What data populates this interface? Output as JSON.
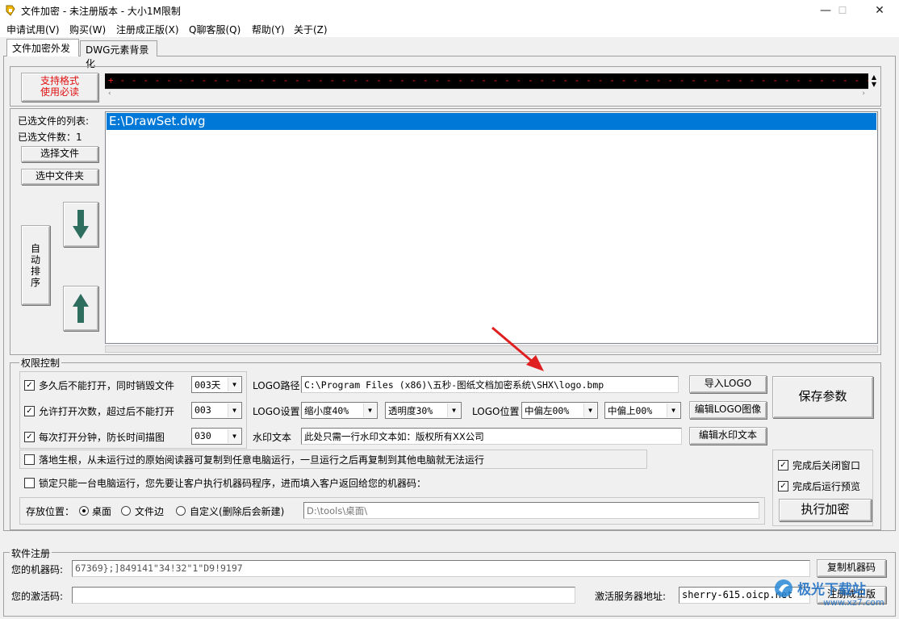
{
  "window": {
    "title": "文件加密 - 未注册版本 - 大小1M限制",
    "minimize": "—",
    "maximize": "☐",
    "close": "✕"
  },
  "menu": [
    "申请试用(V)",
    "购买(W)",
    "注册成正版(X)",
    "Q聊客服(Q)",
    "帮助(Y)",
    "关于(Z)"
  ],
  "tabs": [
    "文件加密外发",
    "DWG元素背景化"
  ],
  "support_button": "支持格式\n使用必读",
  "banner_text": "+ - - - - - - - - - - - - - - - - - - - - - - - - - - - - - - - - - - - - - - - - - - - - - - - - - - - - - - - - - - - - - - - - - - - - - - - - - +",
  "file_list": {
    "list_label": "已选文件的列表:",
    "count_label": "已选文件数：1",
    "select_files": "选择文件",
    "select_folder": "选中文件夹",
    "auto_sort": "自\n动\n排\n序",
    "items": [
      "E:\\DrawSet.dwg"
    ]
  },
  "permission": {
    "group_title": "权限控制",
    "opt1": {
      "checked": true,
      "label": "多久后不能打开，同时销毁文件",
      "value": "003天"
    },
    "opt2": {
      "checked": true,
      "label": "允许打开次数，超过后不能打开",
      "value": "003"
    },
    "opt3": {
      "checked": true,
      "label": "每次打开分钟，防长时间描图",
      "value": "030"
    },
    "logo_path_label": "LOGO路径",
    "logo_path_value": "C:\\Program Files (x86)\\五秒-图纸文档加密系统\\SHX\\logo.bmp",
    "logo_settings_label": "LOGO设置",
    "scale_value": "缩小度40%",
    "opacity_value": "透明度30%",
    "logo_pos_label": "LOGO位置",
    "pos_x_value": "中偏左00%",
    "pos_y_value": "中偏上00%",
    "watermark_label": "水印文本",
    "watermark_value": "此处只需一行水印文本如：版权所有XX公司",
    "import_logo": "导入LOGO",
    "edit_logo": "编辑LOGO图像",
    "edit_watermark": "编辑水印文本",
    "save_params": "保存参数",
    "root_opt": {
      "checked": false,
      "label": "落地生根，从未运行过的原始阅读器可复制到任意电脑运行，一旦运行之后再复制到其他电脑就无法运行"
    },
    "lock_opt": {
      "checked": false,
      "label": "锁定只能一台电脑运行，您先要让客户执行机器码程序，进而填入客户返回给您的机器码："
    },
    "close_after": {
      "checked": true,
      "label": "完成后关闭窗口"
    },
    "preview_after": {
      "checked": true,
      "label": "完成后运行预览"
    },
    "run_encrypt": "执行加密",
    "save_location_label": "存放位置：",
    "loc_desktop": "桌面",
    "loc_fileside": "文件边",
    "loc_custom": "自定义(删除后会新建)",
    "loc_path": "D:\\tools\\桌面\\"
  },
  "registration": {
    "group_title": "软件注册",
    "machine_label": "您的机器码:",
    "machine_code": "67369};]849141\"34!32\"1\"D9!9197",
    "copy_machine": "复制机器码",
    "activation_label": "您的激活码:",
    "activation_code": "",
    "server_label": "激活服务器地址:",
    "server_value": "sherry-615.oicp.net",
    "register": "注册成正版"
  },
  "watermark_site": {
    "name": "极光下载站",
    "url": "www.xz7.com"
  },
  "colors": {
    "selection": "#0078d7",
    "banner_dash": "#ff0000",
    "arrow": "#2e6e5e",
    "annotation_arrow": "#e02020"
  }
}
